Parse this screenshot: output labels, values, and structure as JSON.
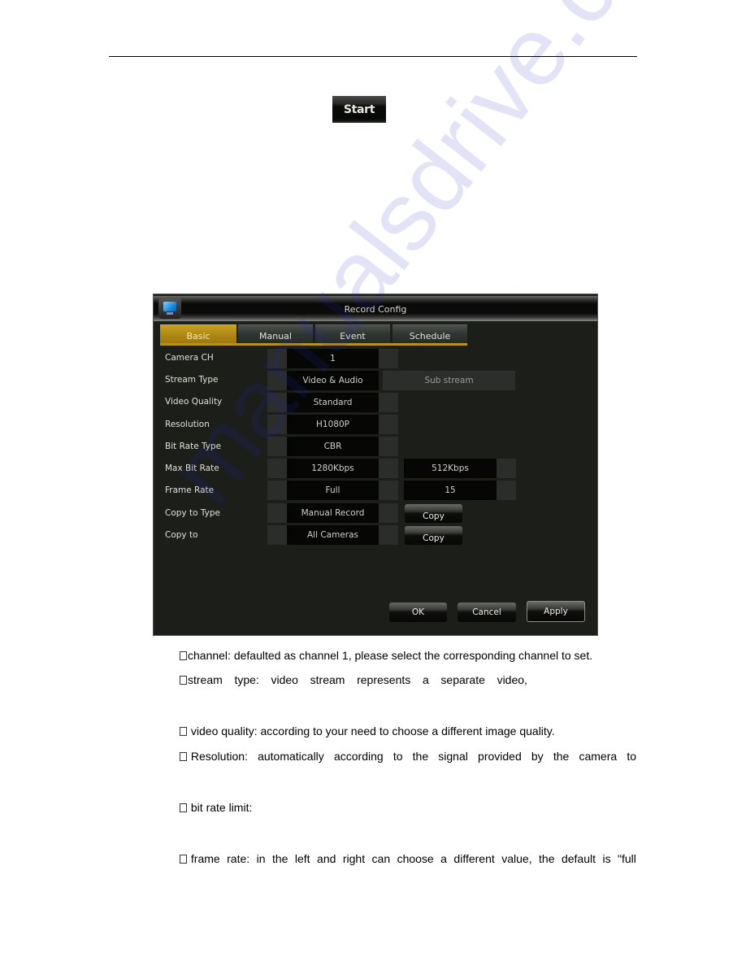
{
  "start_button": {
    "label": "Start"
  },
  "dialog": {
    "title": "Record Config",
    "tabs": [
      {
        "label": "Basic",
        "active": true
      },
      {
        "label": "Manual",
        "active": false
      },
      {
        "label": "Event",
        "active": false
      },
      {
        "label": "Schedule",
        "active": false
      }
    ],
    "fields": {
      "camera_ch": {
        "label": "Camera CH",
        "value": "1"
      },
      "stream_type": {
        "label": "Stream Type",
        "value": "Video & Audio",
        "sub_label": "Sub stream"
      },
      "video_quality": {
        "label": "Video Quality",
        "value": "Standard"
      },
      "resolution": {
        "label": "Resolution",
        "value": "H1080P"
      },
      "bit_rate_type": {
        "label": "Bit Rate Type",
        "value": "CBR"
      },
      "max_bit_rate": {
        "label": "Max Bit Rate",
        "value": "1280Kbps",
        "sub_value": "512Kbps"
      },
      "frame_rate": {
        "label": "Frame Rate",
        "value": "Full",
        "sub_value": "15"
      },
      "copy_to_type": {
        "label": "Copy to Type",
        "value": "Manual Record",
        "button": "Copy"
      },
      "copy_to": {
        "label": "Copy to",
        "value": "All Cameras",
        "button": "Copy"
      }
    },
    "buttons": {
      "ok": "OK",
      "cancel": "Cancel",
      "apply": "Apply"
    }
  },
  "watermark": "manualsdrive.com",
  "paragraphs": [
    {
      "bullet": true,
      "words": [
        "channel: defaulted as channel 1, please select the corresponding channel to set."
      ]
    },
    {
      "bullet": true,
      "words": [
        "stream",
        "type:",
        "video",
        "stream",
        "represents",
        "a",
        "separate",
        "video,"
      ]
    },
    {
      "bullet": true,
      "words": [
        "video quality: according to your need to choose a different image quality."
      ]
    },
    {
      "bullet": true,
      "words": [
        "Resolution:",
        "automatically",
        "according",
        "to",
        "the",
        "signal",
        "provided",
        "by",
        "the",
        "camera",
        "to"
      ]
    },
    {
      "bullet": true,
      "words": [
        "bit rate limit:"
      ]
    },
    {
      "bullet": true,
      "words": [
        "frame",
        "rate:",
        "in",
        "the",
        "left",
        "and",
        "right",
        "can",
        "choose",
        "a",
        "different",
        "value,",
        "the",
        "default",
        "is",
        "\"full"
      ]
    }
  ]
}
